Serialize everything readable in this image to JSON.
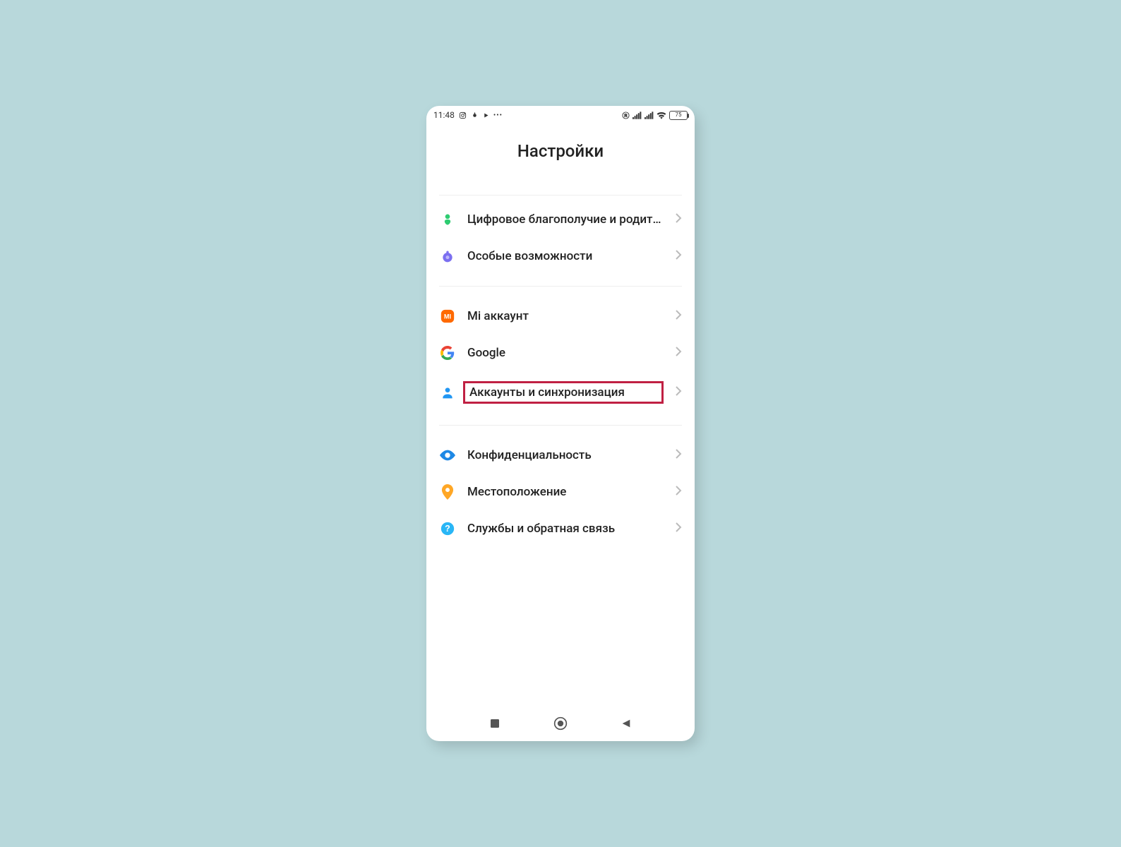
{
  "statusbar": {
    "time": "11:48",
    "battery": "75"
  },
  "title": "Настройки",
  "groups": [
    {
      "items": [
        {
          "key": "wellbeing",
          "label": "Цифровое благополучие и родит…"
        },
        {
          "key": "accessibility",
          "label": "Особые возможности"
        }
      ]
    },
    {
      "items": [
        {
          "key": "mi-account",
          "label": "Mi аккаунт"
        },
        {
          "key": "google",
          "label": "Google"
        },
        {
          "key": "accounts-sync",
          "label": "Аккаунты и синхронизация",
          "highlighted": true
        }
      ]
    },
    {
      "items": [
        {
          "key": "privacy",
          "label": "Конфиденциальность"
        },
        {
          "key": "location",
          "label": "Местоположение"
        },
        {
          "key": "feedback",
          "label": "Службы и обратная связь"
        }
      ]
    }
  ]
}
